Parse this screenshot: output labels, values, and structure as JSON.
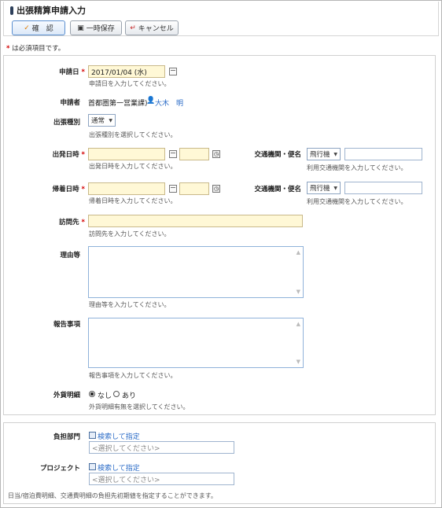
{
  "header": {
    "title": "出張精算申請入力",
    "buttons": {
      "confirm": "確　認",
      "temp_save": "一時保存",
      "cancel": "キャンセル"
    }
  },
  "required_note": "は必須項目です。",
  "required_mark": "*",
  "form": {
    "apply_date": {
      "label": "申請日",
      "value": "2017/01/04 (水)",
      "hint": "申請日を入力してください。"
    },
    "applicant": {
      "label": "申請者",
      "department": "首都圏第一営業課)",
      "name": "大木　明"
    },
    "trip_type": {
      "label": "出張種別",
      "value": "通常",
      "hint": "出張種別を選択してください。"
    },
    "depart_datetime": {
      "label": "出発日時",
      "hint": "出発日時を入力してください。"
    },
    "depart_transport": {
      "label": "交通機関・便名",
      "value": "飛行機",
      "hint": "利用交通機関を入力してください。"
    },
    "return_datetime": {
      "label": "帰着日時",
      "hint": "帰着日時を入力してください。"
    },
    "return_transport": {
      "label": "交通機関・便名",
      "value": "飛行機",
      "hint": "利用交通機関を入力してください。"
    },
    "destination": {
      "label": "訪問先",
      "hint": "訪問先を入力してください。"
    },
    "reason": {
      "label": "理由等",
      "hint": "理由等を入力してください。"
    },
    "report": {
      "label": "報告事項",
      "hint": "報告事項を入力してください。"
    },
    "foreign_currency": {
      "label": "外貨明細",
      "opt_no": "なし",
      "opt_yes": "あり",
      "hint": "外貨明細有無を選択してください。"
    }
  },
  "bottom": {
    "burden_dept": {
      "label": "負担部門",
      "search_link": "検索して指定",
      "placeholder": "<選択してください>"
    },
    "project": {
      "label": "プロジェクト",
      "search_link": "検索して指定",
      "placeholder": "<選択してください>"
    },
    "note": "日当/宿泊費明細、交通費明細の負担先初期値を指定することができます。"
  },
  "icons": {
    "check": "✓",
    "save": "floppy-icon",
    "cancel": "return-icon"
  }
}
